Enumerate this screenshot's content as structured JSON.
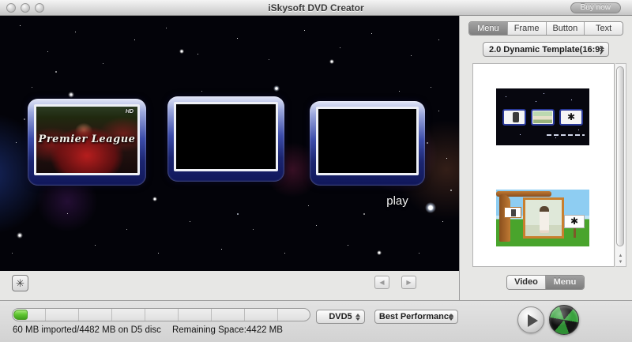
{
  "window": {
    "title": "iSkysoft DVD Creator",
    "buy_now": "Buy now"
  },
  "menu_preview": {
    "clip_title": "Premier League",
    "hd_badge": "HD",
    "play_label": "play"
  },
  "sidebar": {
    "tabs": [
      {
        "label": "Menu",
        "selected": true
      },
      {
        "label": "Frame",
        "selected": false
      },
      {
        "label": "Button",
        "selected": false
      },
      {
        "label": "Text",
        "selected": false
      }
    ],
    "template_dropdown": "2.0 Dynamic Template(16:9)",
    "templates": [
      {
        "name": "space-dynamic-template"
      },
      {
        "name": "cartoon-tree-template"
      }
    ],
    "view_toggle": {
      "video": "Video",
      "menu": "Menu",
      "selected": "Menu"
    }
  },
  "statusbar": {
    "imported_text": "60 MB imported/4482 MB on D5 disc",
    "remaining_text": "Remaining Space:4422 MB",
    "disc_select": "DVD5",
    "quality_select": "Best Performance",
    "progress_percent": 1.3
  },
  "colors": {
    "accent_green": "#62c832",
    "frame_navy": "#1b2570",
    "selected_tab_gray": "#8a8a8a"
  }
}
